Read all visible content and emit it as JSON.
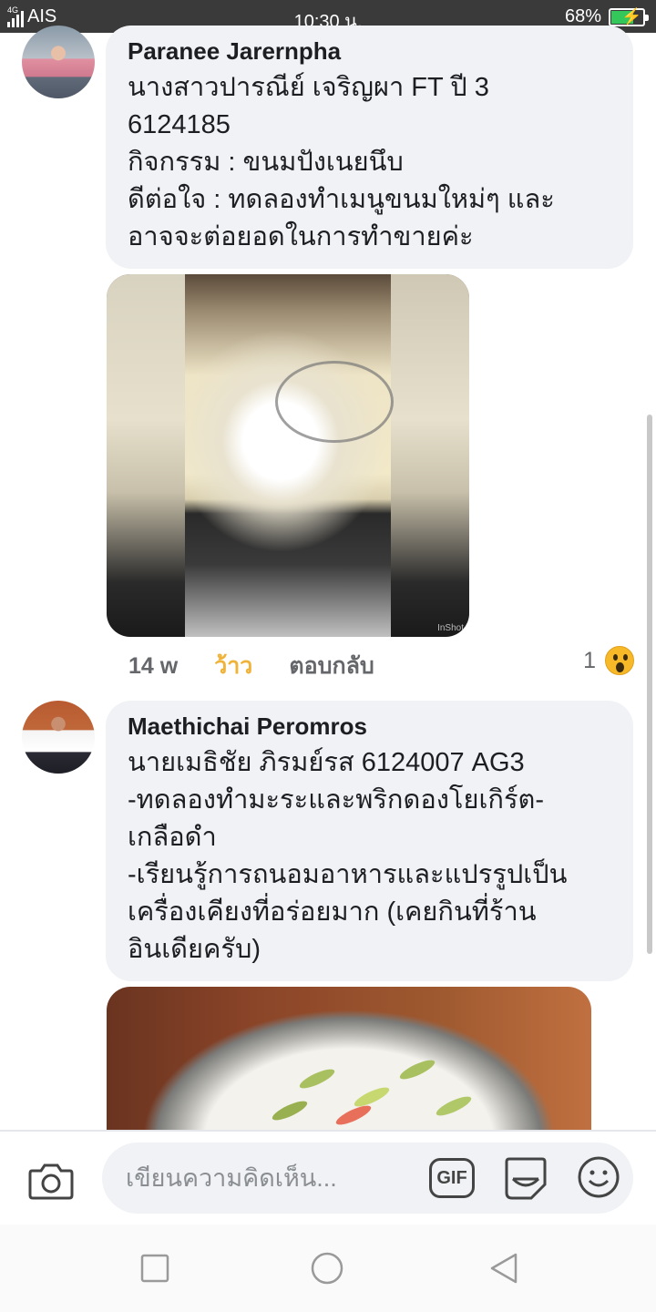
{
  "status_bar": {
    "network": "4G",
    "carrier": "AIS",
    "time": "10:30 น.",
    "battery": "68%",
    "battery_level": 0.68
  },
  "comments": [
    {
      "author": "Paranee Jarernpha",
      "text": "นางสาวปารณีย์ เจริญผา FT ปี 3\n6124185\nกิจกรรม : ขนมปังเนยนึบ\nดีต่อใจ : ทดลองทำเมนูขนมใหม่ๆ และ\nอาจจะต่อยอดในการทำขายค่ะ",
      "photo_watermark": "InShot",
      "time": "14 w",
      "reaction_label": "ว้าว",
      "reply_label": "ตอบกลับ",
      "reaction_count": "1",
      "reaction_icon": "wow-icon"
    },
    {
      "author": "Maethichai Peromros",
      "text": "นายเมธิชัย ภิรมย์รส 6124007 AG3\n-ทดลองทำมะระและพริกดองโยเกิร์ต-\nเกลือดำ\n-เรียนรู้การถนอมอาหารและแปรรูปเป็น\nเครื่องเคียงที่อร่อยมาก (เคยกินที่ร้าน\nอินเดียครับ)"
    }
  ],
  "composer": {
    "placeholder": "เขียนความคิดเห็น...",
    "gif_label": "GIF",
    "icons": [
      "camera-icon",
      "gif-icon",
      "sticker-icon",
      "emoji-icon"
    ]
  },
  "nav_bar": {
    "icons": [
      "recent-apps-icon",
      "home-icon",
      "back-icon"
    ]
  },
  "colors": {
    "bubble": "#f0f2f5",
    "wow_text": "#f0b33a",
    "meta_text": "#65676b",
    "battery_fill": "#34c759"
  }
}
